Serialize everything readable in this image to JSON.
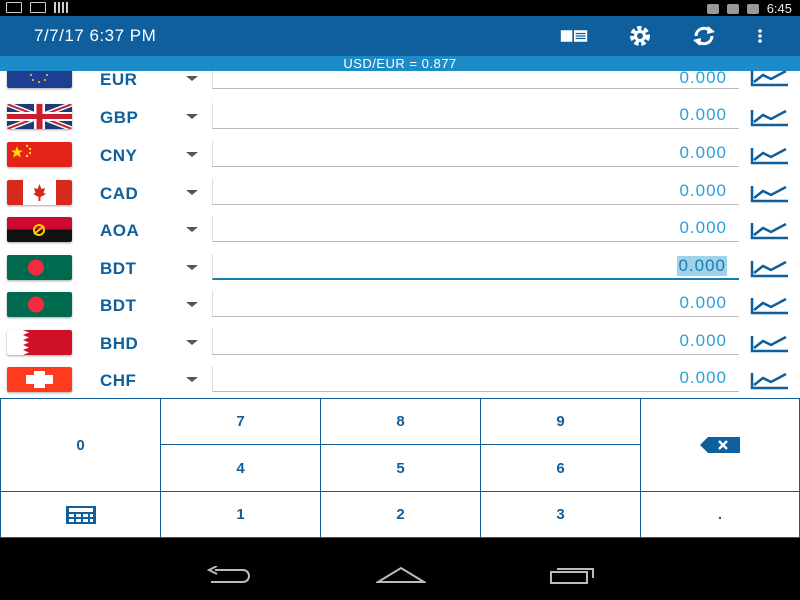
{
  "status_bar": {
    "time": "6:45"
  },
  "app_bar": {
    "title": "7/7/17 6:37 PM",
    "actions": [
      "list-icon",
      "gear-icon",
      "refresh-icon",
      "more-vert-icon"
    ]
  },
  "rate_strip": {
    "text": "USD/EUR = 0.877"
  },
  "currencies": [
    {
      "code": "EUR",
      "amount": "0.000",
      "flag": "eu-flag-icon"
    },
    {
      "code": "GBP",
      "amount": "0.000",
      "flag": "uk-flag-icon"
    },
    {
      "code": "CNY",
      "amount": "0.000",
      "flag": "china-flag-icon"
    },
    {
      "code": "CAD",
      "amount": "0.000",
      "flag": "canada-flag-icon"
    },
    {
      "code": "AOA",
      "amount": "0.000",
      "flag": "angola-flag-icon"
    },
    {
      "code": "BDT",
      "amount": "0.000",
      "flag": "bangladesh-flag-icon",
      "active": true
    },
    {
      "code": "BDT",
      "amount": "0.000",
      "flag": "bangladesh-flag-icon"
    },
    {
      "code": "BHD",
      "amount": "0.000",
      "flag": "bahrain-flag-icon"
    },
    {
      "code": "CHF",
      "amount": "0.000",
      "flag": "switzerland-flag-icon"
    }
  ],
  "keypad": {
    "k0": "0",
    "k1": "1",
    "k2": "2",
    "k3": "3",
    "k4": "4",
    "k5": "5",
    "k6": "6",
    "k7": "7",
    "k8": "8",
    "k9": "9",
    "dot": ".",
    "backspace": "backspace-icon",
    "calculator": "calculator-icon"
  },
  "nav_bar": [
    "back-icon",
    "home-icon",
    "recents-icon"
  ],
  "colors": {
    "primary": "#0f5f9c",
    "strip": "#1c8bc7",
    "amount": "#2ba0d6"
  }
}
